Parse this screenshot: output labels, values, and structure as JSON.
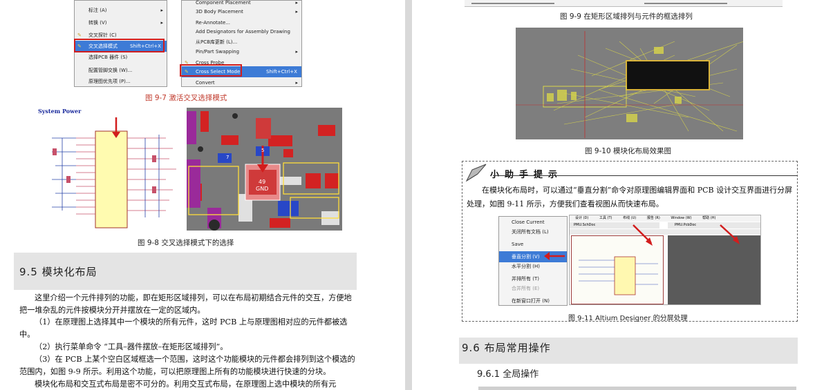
{
  "left_page": {
    "menu_a": {
      "items": [
        {
          "label": "标注 (A)",
          "arrow": "▸"
        },
        {
          "label": "转换 (V)",
          "arrow": "▸"
        },
        {
          "label": "交叉探针 (C)"
        },
        {
          "label": "交叉选择模式",
          "shortcut": "Shift+Ctrl+X"
        },
        {
          "label": "选择PCB 器件 (S)"
        },
        {
          "label": "配置管脚交换 (W)..."
        },
        {
          "label": "原理图优先项 (P)..."
        }
      ]
    },
    "menu_b": {
      "items": [
        {
          "label": "Component Placement",
          "arrow": "▸"
        },
        {
          "label": "3D Body Placement",
          "arrow": "▸"
        },
        {
          "label": "Re-Annotate..."
        },
        {
          "label": "Add Designators for Assembly Drawing"
        },
        {
          "label": "从PCB库更新 (L)..."
        },
        {
          "label": "Pin/Part Swapping",
          "arrow": "▸"
        },
        {
          "label": "Cross Probe"
        },
        {
          "label": "Cross Select Mode",
          "shortcut": "Shift+Ctrl+X"
        },
        {
          "label": "Convert",
          "arrow": "▸"
        }
      ]
    },
    "fig97_caption": "图 9-7   激活交叉选择模式",
    "schematic_title": "System Power",
    "pcb_labels": [
      "7",
      "5",
      "49",
      "GND"
    ],
    "fig98_caption": "图 9-8   交叉选择模式下的选择",
    "section_95_title": "9.5   模块化布局",
    "paragraphs": [
      "这里介绍一个元件排列的功能，即在矩形区域排列，可以在布局初期结合元件的交互，方便地把一堆杂乱的元件按模块分开并摆放在一定的区域内。",
      "（1）在原理图上选择其中一个模块的所有元件，这时 PCB 上与原理图相对应的元件都被选中。",
      "（2）执行菜单命令 “工具–器件摆放–在矩形区域排列”。",
      "（3）在 PCB 上某个空白区域框选一个范围，这时这个功能模块的元件都会排列到这个模选的范围内，如图 9-9 所示。利用这个功能，可以把原理图上所有的功能模块进行快速的分块。",
      "模块化布局和交互式布局是密不可分的。利用交互式布局，在原理图上选中模块的所有元"
    ]
  },
  "right_page": {
    "fig99_caption": "图 9-9   在矩形区域排列与元件的框选排列",
    "fig910_caption": "图 9-10   模块化布局效果图",
    "tip": {
      "title": "小助手提示",
      "text": "在模块化布局时，可以通过“垂直分割”命令对原理图编辑界面和 PCB 设计交互界面进行分屏处理，如图 9-11 所示，方便我们查看视图从而快速布局。"
    },
    "ctx_menu": {
      "items": [
        {
          "label": "Close Current"
        },
        {
          "label": "关闭所有文档 (L)"
        },
        {
          "label": "Save"
        },
        {
          "label": "垂直分割 (V)"
        },
        {
          "label": "水平分割 (H)"
        },
        {
          "label": "并排所有 (T)"
        },
        {
          "label": "合并所有 (E)"
        },
        {
          "label": "在新窗口打开 (N)"
        }
      ]
    },
    "split_tabs": [
      "PMU.SchDoc",
      "PMU.PcbDoc"
    ],
    "split_menubar": [
      "设计 (D)",
      "工具 (T)",
      "布线 (U)",
      "报告 (R)",
      "Window (W)",
      "帮助 (H)"
    ],
    "fig911_caption": "图 9-11   Altium Designer 的分屏处理",
    "section_96_title": "9.6   布局常用操作",
    "subsection_961_title": "9.6.1   全局操作",
    "colors": {
      "highlight_red": "#d21d1d",
      "caption_red": "#c0392b",
      "menu_select_blue": "#3d7bd6",
      "pcb_board": "#7a7a7a",
      "pcb_red": "#d32222"
    }
  }
}
